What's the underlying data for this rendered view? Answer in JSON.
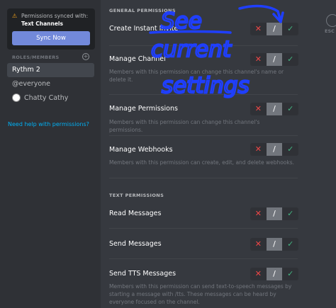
{
  "sidebar": {
    "sync_notice": "Permissions synced with:",
    "sync_channel": "Text Channels",
    "sync_button": "Sync Now",
    "roles_header": "ROLES/MEMBERS",
    "roles": [
      {
        "label": "Rythm 2",
        "selected": true
      },
      {
        "label": "@everyone",
        "selected": false
      },
      {
        "label": "Chatty Cathy",
        "selected": false,
        "avatar": true
      }
    ],
    "help_link": "Need help with permissions?"
  },
  "main": {
    "general_header": "GENERAL PERMISSIONS",
    "text_header": "TEXT PERMISSIONS",
    "esc_label": "ESC",
    "permissions": [
      {
        "name": "Create Instant Invite",
        "desc": "",
        "state": "pass"
      },
      {
        "name": "Manage Channel",
        "desc": "Members with this permission can change this channel's name or delete it.",
        "state": "pass"
      },
      {
        "name": "Manage Permissions",
        "desc": "Members with this permission can change this channel's permissions.",
        "state": "pass"
      },
      {
        "name": "Manage Webhooks",
        "desc": "Members with this permission can create, edit, and delete webhooks.",
        "state": "pass"
      },
      {
        "name": "Read Messages",
        "desc": "",
        "state": "pass"
      },
      {
        "name": "Send Messages",
        "desc": "",
        "state": "pass"
      },
      {
        "name": "Send TTS Messages",
        "desc": "Members with this permission can send text-to-speech messages by starting a message with /tts. These messages can be heard by everyone focused on the channel.",
        "state": "pass"
      }
    ],
    "toggle_glyphs": {
      "deny": "✕",
      "pass": "/",
      "allow": "✓"
    }
  },
  "annotation": {
    "lines": [
      "See",
      "current",
      "settings"
    ],
    "color": "#1f3fff"
  }
}
